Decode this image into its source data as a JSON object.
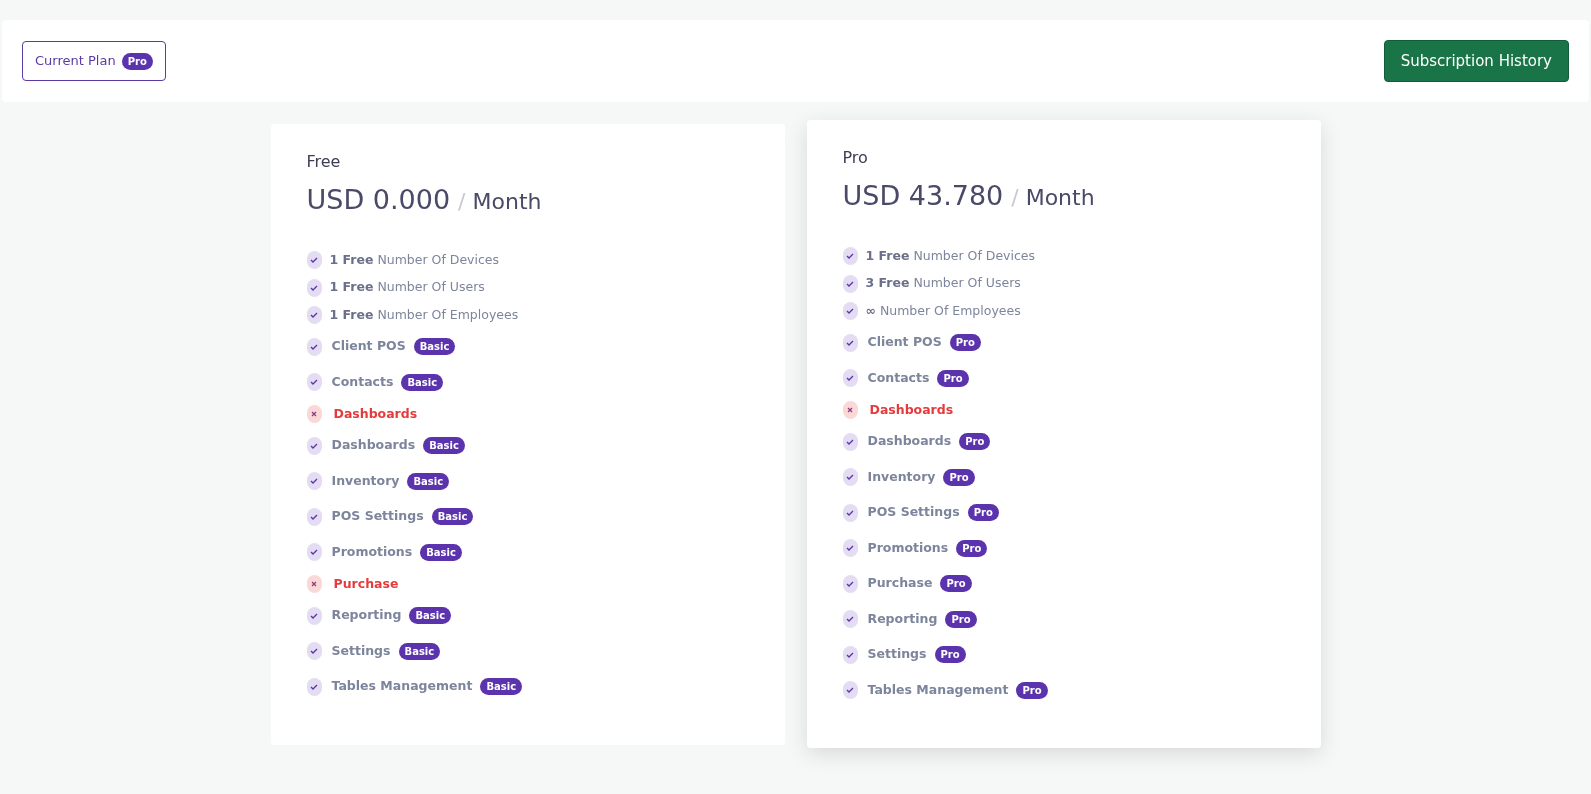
{
  "header": {
    "current_plan": {
      "label": "Current Plan",
      "badge": "Pro"
    },
    "history_button": "Subscription History"
  },
  "plans": [
    {
      "name": "Free",
      "price": "USD 0.000",
      "period": "/ Month",
      "highlighted": false,
      "items": [
        {
          "kind": "quota",
          "count": "1 Free",
          "label": "Number Of Devices"
        },
        {
          "kind": "quota",
          "count": "1 Free",
          "label": "Number Of Users"
        },
        {
          "kind": "quota",
          "count": "1 Free",
          "label": "Number Of Employees"
        },
        {
          "kind": "feature",
          "label": "Client POS",
          "included": true,
          "tier": "Basic"
        },
        {
          "kind": "feature",
          "label": "Contacts",
          "included": true,
          "tier": "Basic"
        },
        {
          "kind": "feature",
          "label": "Dashboards",
          "included": false
        },
        {
          "kind": "feature",
          "label": "Dashboards",
          "included": true,
          "tier": "Basic"
        },
        {
          "kind": "feature",
          "label": "Inventory",
          "included": true,
          "tier": "Basic"
        },
        {
          "kind": "feature",
          "label": "POS Settings",
          "included": true,
          "tier": "Basic"
        },
        {
          "kind": "feature",
          "label": "Promotions",
          "included": true,
          "tier": "Basic"
        },
        {
          "kind": "feature",
          "label": "Purchase",
          "included": false
        },
        {
          "kind": "feature",
          "label": "Reporting",
          "included": true,
          "tier": "Basic"
        },
        {
          "kind": "feature",
          "label": "Settings",
          "included": true,
          "tier": "Basic"
        },
        {
          "kind": "feature",
          "label": "Tables Management",
          "included": true,
          "tier": "Basic"
        }
      ]
    },
    {
      "name": "Pro",
      "price": "USD 43.780",
      "period": "/ Month",
      "highlighted": true,
      "items": [
        {
          "kind": "quota",
          "count": "1 Free",
          "label": "Number Of Devices"
        },
        {
          "kind": "quota",
          "count": "3 Free",
          "label": "Number Of Users"
        },
        {
          "kind": "quota",
          "count": "∞",
          "label": "Number Of Employees"
        },
        {
          "kind": "feature",
          "label": "Client POS",
          "included": true,
          "tier": "Pro"
        },
        {
          "kind": "feature",
          "label": "Contacts",
          "included": true,
          "tier": "Pro"
        },
        {
          "kind": "feature",
          "label": "Dashboards",
          "included": false
        },
        {
          "kind": "feature",
          "label": "Dashboards",
          "included": true,
          "tier": "Pro"
        },
        {
          "kind": "feature",
          "label": "Inventory",
          "included": true,
          "tier": "Pro"
        },
        {
          "kind": "feature",
          "label": "POS Settings",
          "included": true,
          "tier": "Pro"
        },
        {
          "kind": "feature",
          "label": "Promotions",
          "included": true,
          "tier": "Pro"
        },
        {
          "kind": "feature",
          "label": "Purchase",
          "included": true,
          "tier": "Pro"
        },
        {
          "kind": "feature",
          "label": "Reporting",
          "included": true,
          "tier": "Pro"
        },
        {
          "kind": "feature",
          "label": "Settings",
          "included": true,
          "tier": "Pro"
        },
        {
          "kind": "feature",
          "label": "Tables Management",
          "included": true,
          "tier": "Pro"
        }
      ]
    }
  ]
}
